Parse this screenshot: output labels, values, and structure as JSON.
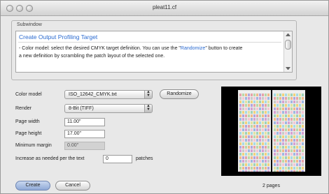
{
  "window": {
    "title": "pleat11.cf"
  },
  "group": {
    "label": "Subwindow"
  },
  "info": {
    "title": "Create Output Profiling Target",
    "line1_prefix": "- Color model: select the desired CMYK target definition. You can use the \"",
    "line1_link": "Randomize",
    "line1_suffix": "\" button to create",
    "line2": "a new definition by scrambling the patch layout of the selected one."
  },
  "form": {
    "color_model_label": "Color model",
    "color_model_value": "ISO_12642_CMYK.txt",
    "randomize_label": "Randomize",
    "render_label": "Render",
    "render_value": "8-Bit (TIFF)",
    "page_width_label": "Page width",
    "page_width_value": "11.00\"",
    "page_height_label": "Page height",
    "page_height_value": "17.00\"",
    "min_margin_label": "Minimum margin",
    "min_margin_value": "0.00\"",
    "increase_label": "Increase as needed per the text",
    "increase_value": "0",
    "increase_unit": "patches"
  },
  "buttons": {
    "create_label": "Create",
    "cancel_label": "Cancel"
  },
  "preview": {
    "pages_label": "2 pages"
  },
  "colors": {
    "accent": "#2a6ad0",
    "create_button": "#9fb6dc"
  }
}
